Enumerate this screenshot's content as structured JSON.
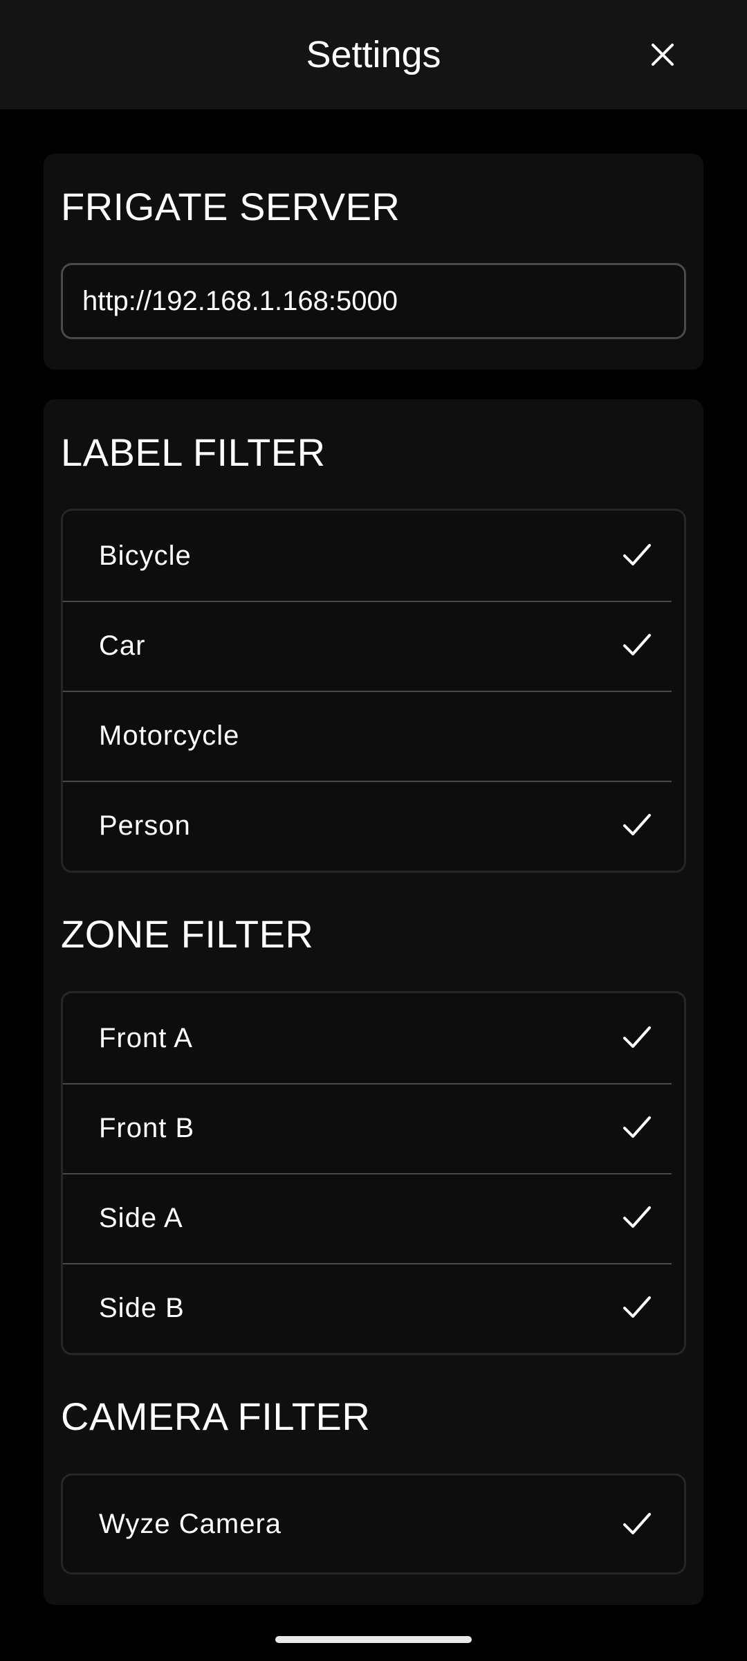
{
  "header": {
    "title": "Settings",
    "close_icon": "close-icon"
  },
  "server": {
    "title": "FRIGATE SERVER",
    "value": "http://192.168.1.168:5000"
  },
  "label_filter": {
    "title": "LABEL FILTER",
    "items": [
      {
        "label": "Bicycle",
        "checked": true
      },
      {
        "label": "Car",
        "checked": true
      },
      {
        "label": "Motorcycle",
        "checked": false
      },
      {
        "label": "Person",
        "checked": true
      }
    ]
  },
  "zone_filter": {
    "title": "ZONE FILTER",
    "items": [
      {
        "label": "Front A",
        "checked": true
      },
      {
        "label": "Front B",
        "checked": true
      },
      {
        "label": "Side A",
        "checked": true
      },
      {
        "label": "Side B",
        "checked": true
      }
    ]
  },
  "camera_filter": {
    "title": "CAMERA FILTER",
    "items": [
      {
        "label": "Wyze Camera",
        "checked": true
      }
    ]
  },
  "colors": {
    "background": "#000000",
    "header": "#141414",
    "card": "#0f0f0f",
    "divider": "#4a4a4a",
    "text": "#ffffff"
  }
}
